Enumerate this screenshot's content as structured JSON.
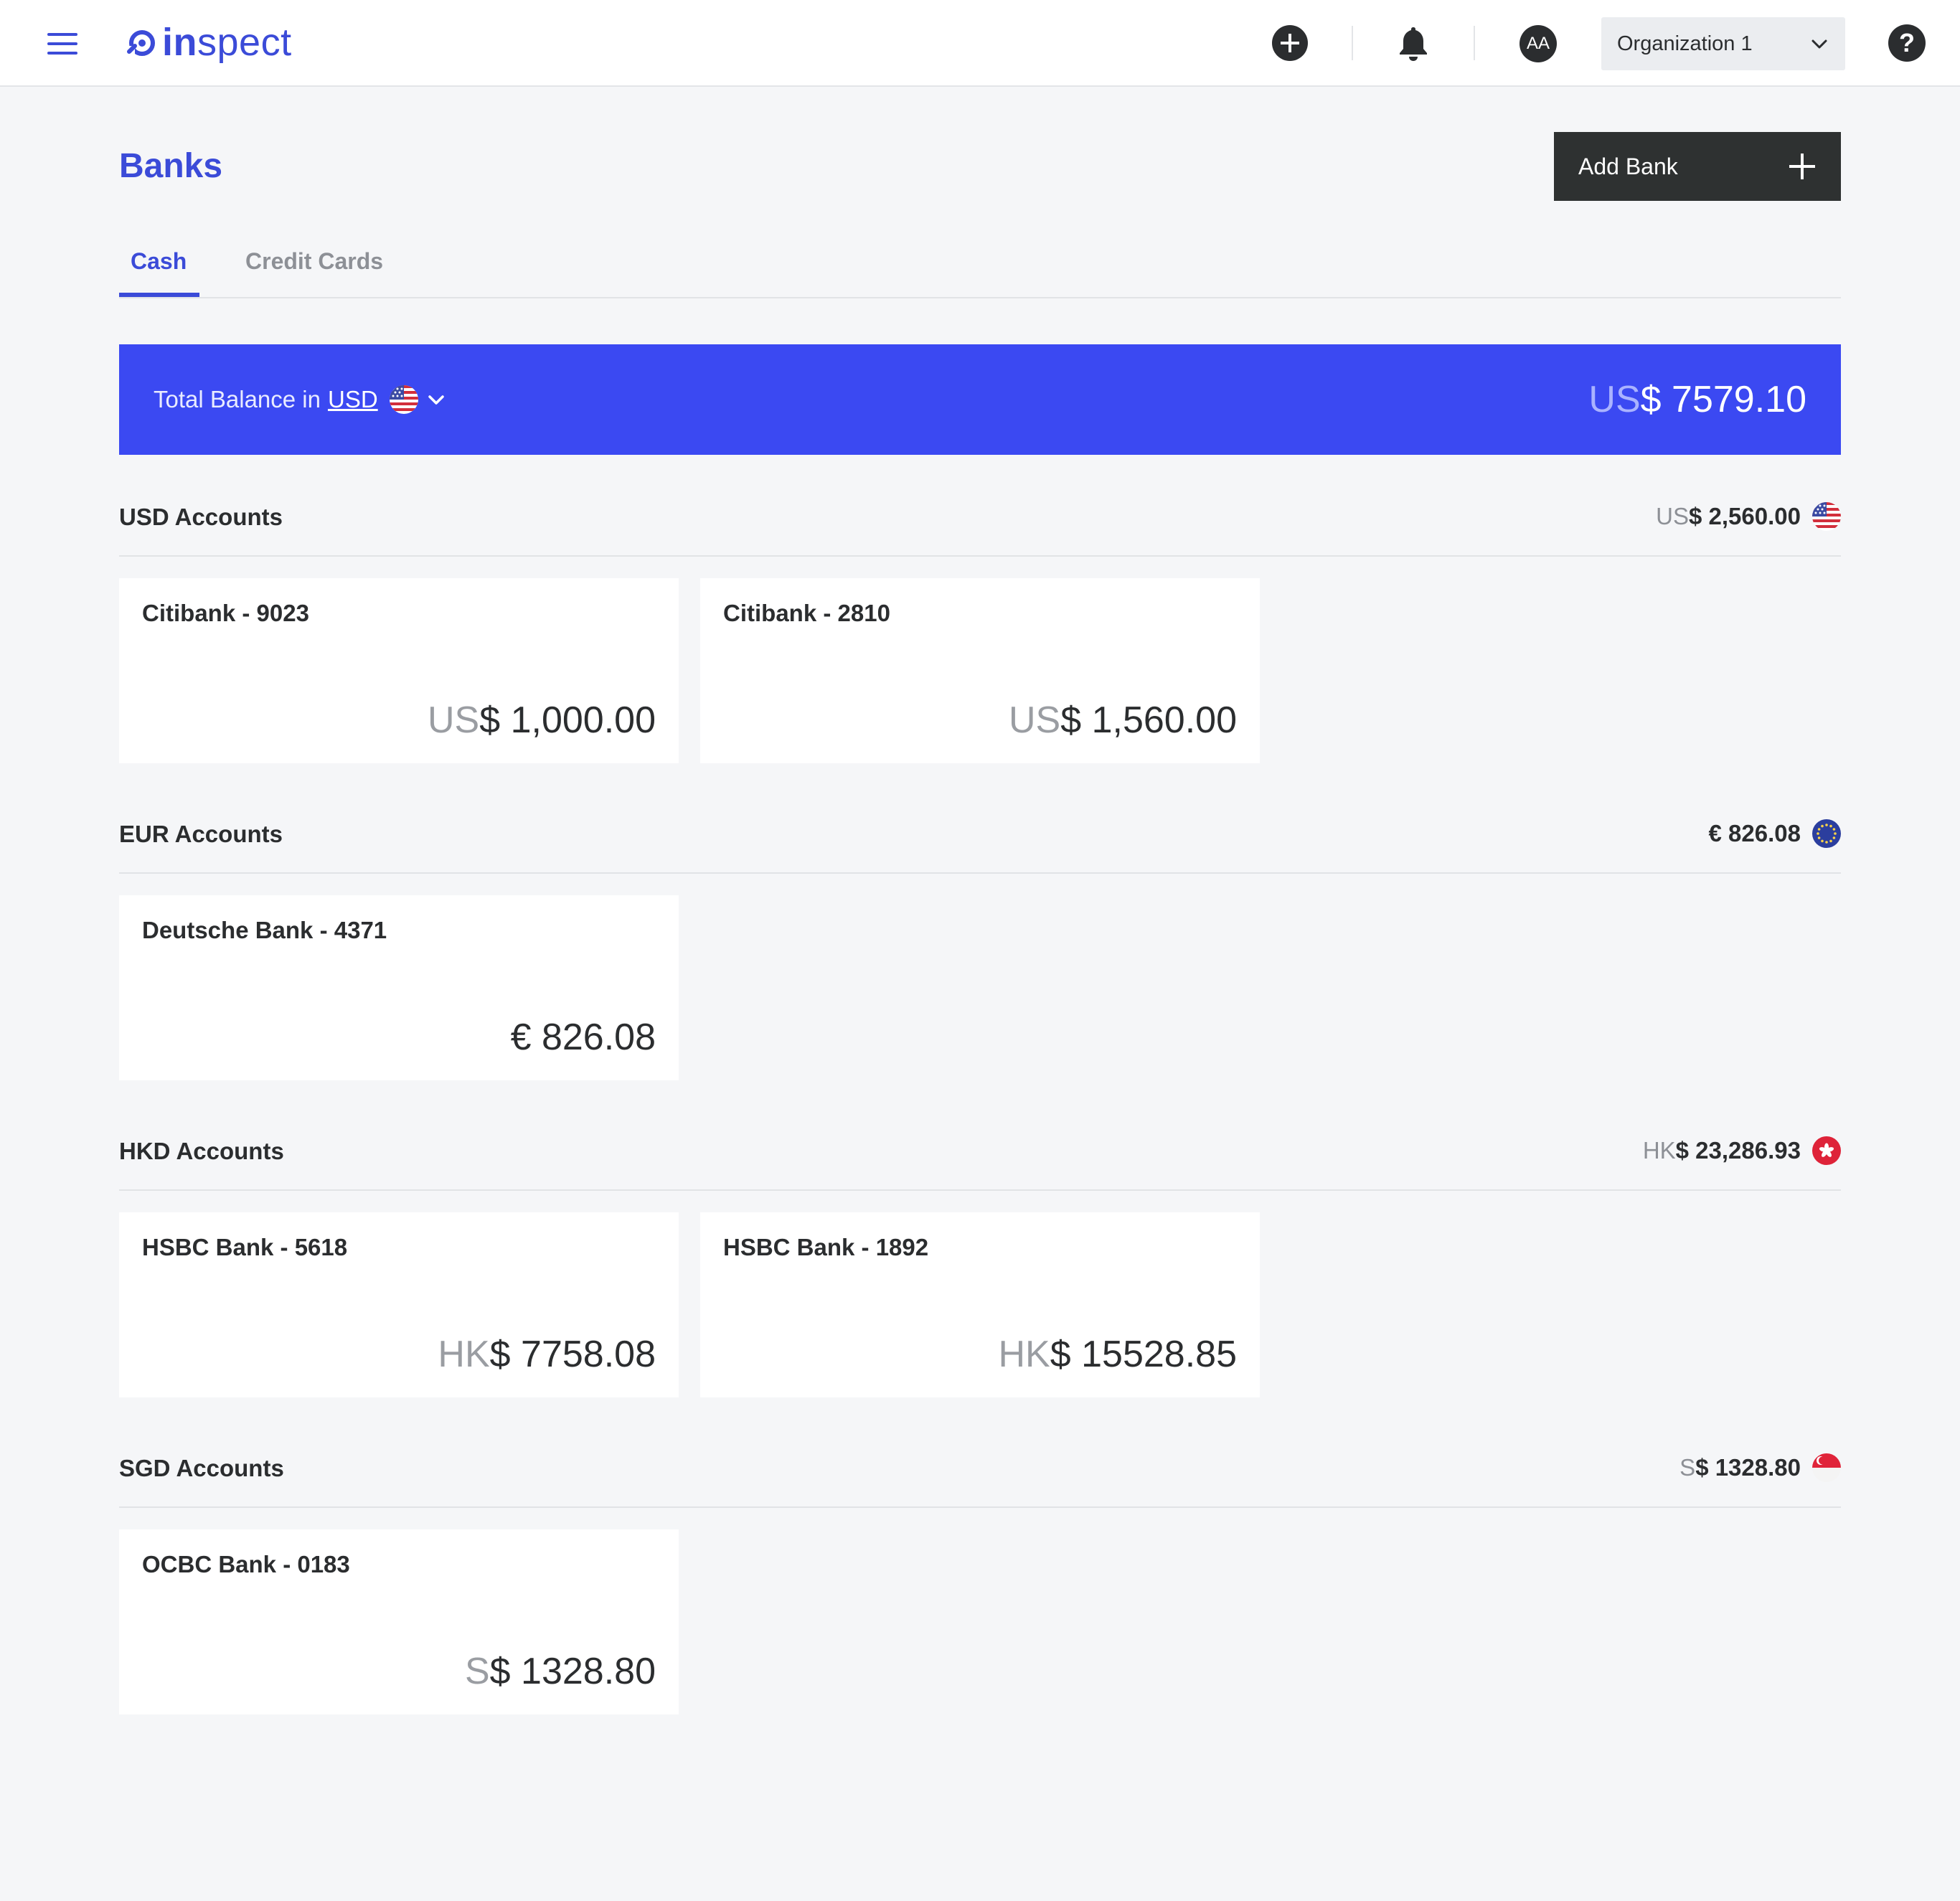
{
  "brand": {
    "name_bold": "in",
    "name_light": "spect"
  },
  "header": {
    "avatar_initials": "AA",
    "org_select": {
      "selected": "Organization 1"
    },
    "help_glyph": "?"
  },
  "page": {
    "title": "Banks",
    "add_bank_label": "Add Bank"
  },
  "tabs": [
    {
      "label": "Cash",
      "active": true
    },
    {
      "label": "Credit Cards",
      "active": false
    }
  ],
  "total": {
    "label": "Total Balance in",
    "currency": "USD",
    "amount_prefix": "US",
    "amount_value": "$ 7579.10"
  },
  "sections": [
    {
      "title": "USD Accounts",
      "total_prefix": "US",
      "total_value": "$ 2,560.00",
      "flag": "us-flag-icon",
      "cards": [
        {
          "name": "Citibank - 9023",
          "prefix": "US",
          "value": "$ 1,000.00"
        },
        {
          "name": "Citibank - 2810",
          "prefix": "US",
          "value": "$ 1,560.00"
        }
      ]
    },
    {
      "title": "EUR Accounts",
      "total_prefix": "",
      "total_value": "€ 826.08",
      "flag": "eu-flag-icon",
      "cards": [
        {
          "name": "Deutsche Bank - 4371",
          "prefix": "",
          "value": "€ 826.08"
        }
      ]
    },
    {
      "title": "HKD Accounts",
      "total_prefix": "HK",
      "total_value": "$ 23,286.93",
      "flag": "hk-flag-icon",
      "cards": [
        {
          "name": "HSBC Bank - 5618",
          "prefix": "HK",
          "value": "$ 7758.08"
        },
        {
          "name": "HSBC Bank - 1892",
          "prefix": "HK",
          "value": "$ 15528.85"
        }
      ]
    },
    {
      "title": "SGD Accounts",
      "total_prefix": "S",
      "total_value": "$ 1328.80",
      "flag": "sg-flag-icon",
      "cards": [
        {
          "name": "OCBC Bank - 0183",
          "prefix": "S",
          "value": "$ 1328.80"
        }
      ]
    }
  ],
  "colors": {
    "accent": "#3b4bd8",
    "banner": "#3b49f2",
    "dark_button": "#2e3131",
    "page_bg": "#f5f6f8"
  }
}
